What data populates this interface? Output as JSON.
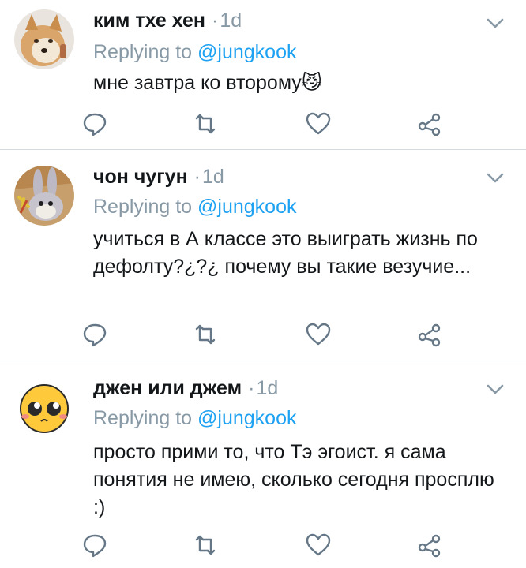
{
  "colors": {
    "accent": "#1da1f2",
    "muted": "#8899a6",
    "text": "#14171a",
    "divider": "#d4dadf"
  },
  "tweets": [
    {
      "name": "ким тхе хен",
      "dot": "·",
      "time": "1d",
      "reply_prefix": "Replying to",
      "reply_handle": "@jungkook",
      "text": "мне завтра ко второму",
      "emoji": "😼",
      "avatar": "shiba-dog-avatar"
    },
    {
      "name": "чон чугун",
      "dot": "·",
      "time": "1d",
      "reply_prefix": "Replying to",
      "reply_handle": "@jungkook",
      "text": "учиться в А классе это выиграть жизнь по дефолту?¿?¿ почему вы такие везучие...",
      "avatar": "bugs-bunny-avatar"
    },
    {
      "name": "джен или джем",
      "dot": "·",
      "time": "1d",
      "reply_prefix": "Replying to",
      "reply_handle": "@jungkook",
      "text": "просто прими то, что Тэ эгоист. я сама понятия не имею, сколько сегодня просплю :)",
      "avatar": "crying-emoji-avatar"
    }
  ],
  "icons": {
    "reply": "reply-icon",
    "retweet": "retweet-icon",
    "like": "heart-icon",
    "share": "share-icon",
    "menu": "chevron-down-icon"
  }
}
